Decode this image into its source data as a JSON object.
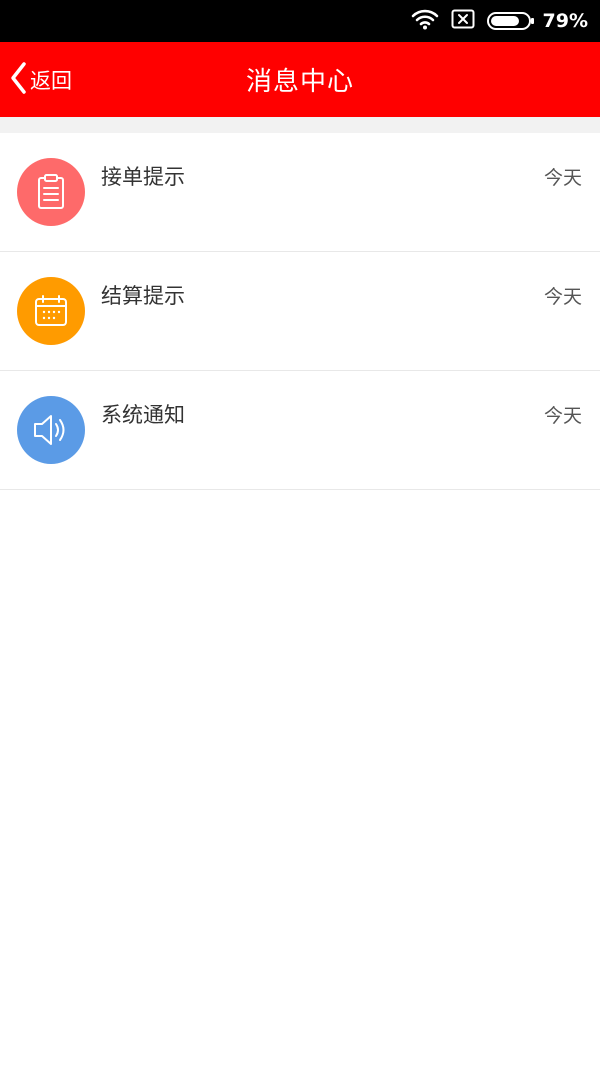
{
  "status_bar": {
    "battery_percent": "79%",
    "battery_level": 0.79,
    "icons": [
      "wifi-icon",
      "no-sim-icon",
      "battery-icon"
    ]
  },
  "nav": {
    "back_label": "返回",
    "title": "消息中心"
  },
  "colors": {
    "nav_red": "#ff0000",
    "order_icon_bg": "#fe6a6a",
    "settlement_icon_bg": "#ff9b00",
    "notice_icon_bg": "#5b9be6"
  },
  "messages": [
    {
      "title": "接单提示",
      "time": "今天",
      "icon": "clipboard-icon"
    },
    {
      "title": "结算提示",
      "time": "今天",
      "icon": "calendar-icon"
    },
    {
      "title": "系统通知",
      "time": "今天",
      "icon": "speaker-icon"
    }
  ]
}
